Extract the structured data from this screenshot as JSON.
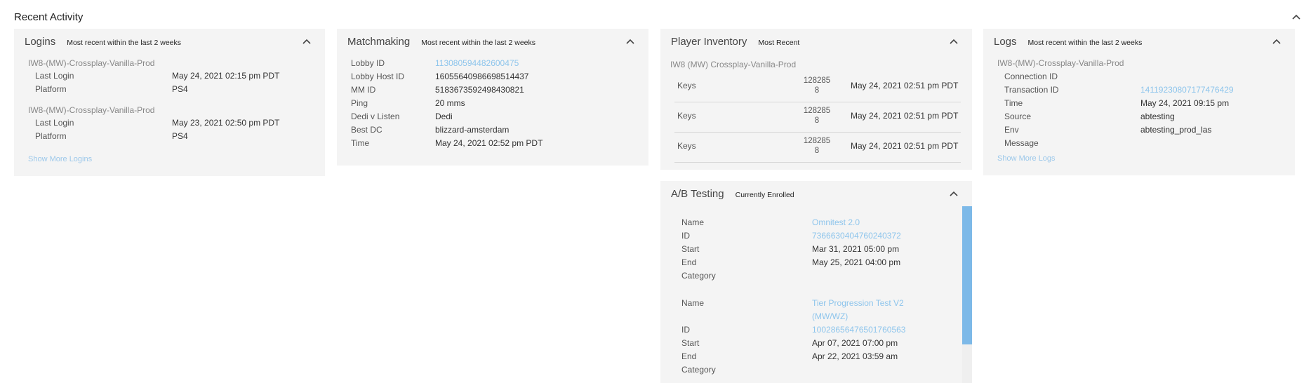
{
  "header": {
    "title": "Recent Activity"
  },
  "logins": {
    "title": "Logins",
    "subtitle": "Most recent within the last 2 weeks",
    "entries": [
      {
        "name": "IW8-(MW)-Crossplay-Vanilla-Prod",
        "last_login_label": "Last Login",
        "last_login": "May 24, 2021 02:15 pm PDT",
        "platform_label": "Platform",
        "platform": "PS4"
      },
      {
        "name": "IW8-(MW)-Crossplay-Vanilla-Prod",
        "last_login_label": "Last Login",
        "last_login": "May 23, 2021 02:50 pm PDT",
        "platform_label": "Platform",
        "platform": "PS4"
      }
    ],
    "show_more": "Show More Logins"
  },
  "matchmaking": {
    "title": "Matchmaking",
    "subtitle": "Most recent within the last 2 weeks",
    "rows": [
      {
        "label": "Lobby ID",
        "value": "113080594482600475"
      },
      {
        "label": "Lobby Host ID",
        "value": "16055640986698514437"
      },
      {
        "label": "MM ID",
        "value": "5183673592498430821"
      },
      {
        "label": "Ping",
        "value": "20 mms"
      },
      {
        "label": "Dedi v Listen",
        "value": "Dedi"
      },
      {
        "label": "Best DC",
        "value": "blizzard-amsterdam"
      },
      {
        "label": "Time",
        "value": "May 24, 2021 02:52 pm PDT"
      }
    ]
  },
  "inventory": {
    "title": "Player Inventory",
    "subtitle": "Most Recent",
    "group": "IW8 (MW) Crossplay-Vanilla-Prod",
    "items": [
      {
        "name": "Keys",
        "qty_line1": "128285",
        "qty_line2": "8",
        "time": "May 24, 2021 02:51 pm PDT"
      },
      {
        "name": "Keys",
        "qty_line1": "128285",
        "qty_line2": "8",
        "time": "May 24, 2021 02:51 pm PDT"
      },
      {
        "name": "Keys",
        "qty_line1": "128285",
        "qty_line2": "8",
        "time": "May 24, 2021 02:51 pm PDT"
      }
    ]
  },
  "logs": {
    "title": "Logs",
    "subtitle": "Most recent within the last 2 weeks",
    "group": "IW8-(MW)-Crossplay-Vanilla-Prod",
    "rows": [
      {
        "label": "Connection ID",
        "value": ""
      },
      {
        "label": "Transaction ID",
        "value": "14119230807177476429"
      },
      {
        "label": "Time",
        "value": "May 24, 2021 09:15 pm"
      },
      {
        "label": "Source",
        "value": "abtesting"
      },
      {
        "label": "Env",
        "value": "abtesting_prod_las"
      },
      {
        "label": "Message",
        "value": ""
      }
    ],
    "show_more": "Show More Logs"
  },
  "abtesting": {
    "title": "A/B Testing",
    "subtitle": "Currently Enrolled",
    "tests": [
      {
        "name_label": "Name",
        "name": "Omnitest 2.0",
        "id_label": "ID",
        "id": "7366630404760240372",
        "start_label": "Start",
        "start": "Mar 31, 2021 05:00 pm",
        "end_label": "End",
        "end": "May 25, 2021 04:00 pm",
        "category_label": "Category",
        "category": ""
      },
      {
        "name_label": "Name",
        "name_line1": "Tier Progression Test V2",
        "name_line2": "(MW/WZ)",
        "id_label": "ID",
        "id": "10028656476501760563",
        "start_label": "Start",
        "start": "Apr 07, 2021 07:00 pm",
        "end_label": "End",
        "end": "Apr 22, 2021 03:59 am",
        "category_label": "Category",
        "category": ""
      }
    ],
    "scroll_position": 0.0
  },
  "colors": {
    "card_bg": "#f4f4f4",
    "link": "#8ec5ec",
    "scroll_thumb": "#7db9e8"
  }
}
